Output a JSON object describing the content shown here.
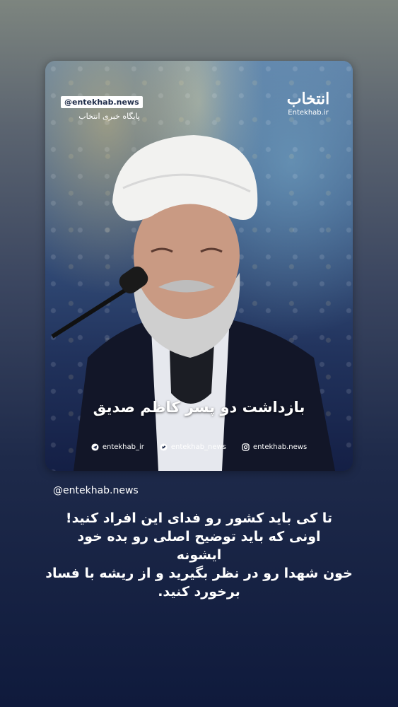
{
  "post": {
    "card": {
      "handle_badge": "@entekhab.news",
      "news_label": "پایگاه خبری انتخاب",
      "logo_text": "انتخاب",
      "logo_sub": "Entekhab.ir",
      "headline": "بازداشت دو پسر کاظم صدیق",
      "socials": [
        {
          "icon": "telegram-icon",
          "label": "entekhab_ir"
        },
        {
          "icon": "twitter-icon",
          "label": "entekhab_news"
        },
        {
          "icon": "instagram-icon",
          "label": "entekhab.news"
        }
      ]
    },
    "handle": "@entekhab.news",
    "caption_lines": [
      "تا کی باید کشور رو فدای این افراد کنید!",
      "اونی که باید توضیح اصلی رو بده خود",
      "ایشونه",
      "خون شهدا رو در نظر بگیرید و از ریشه با فساد",
      "برخورد کنید."
    ]
  }
}
